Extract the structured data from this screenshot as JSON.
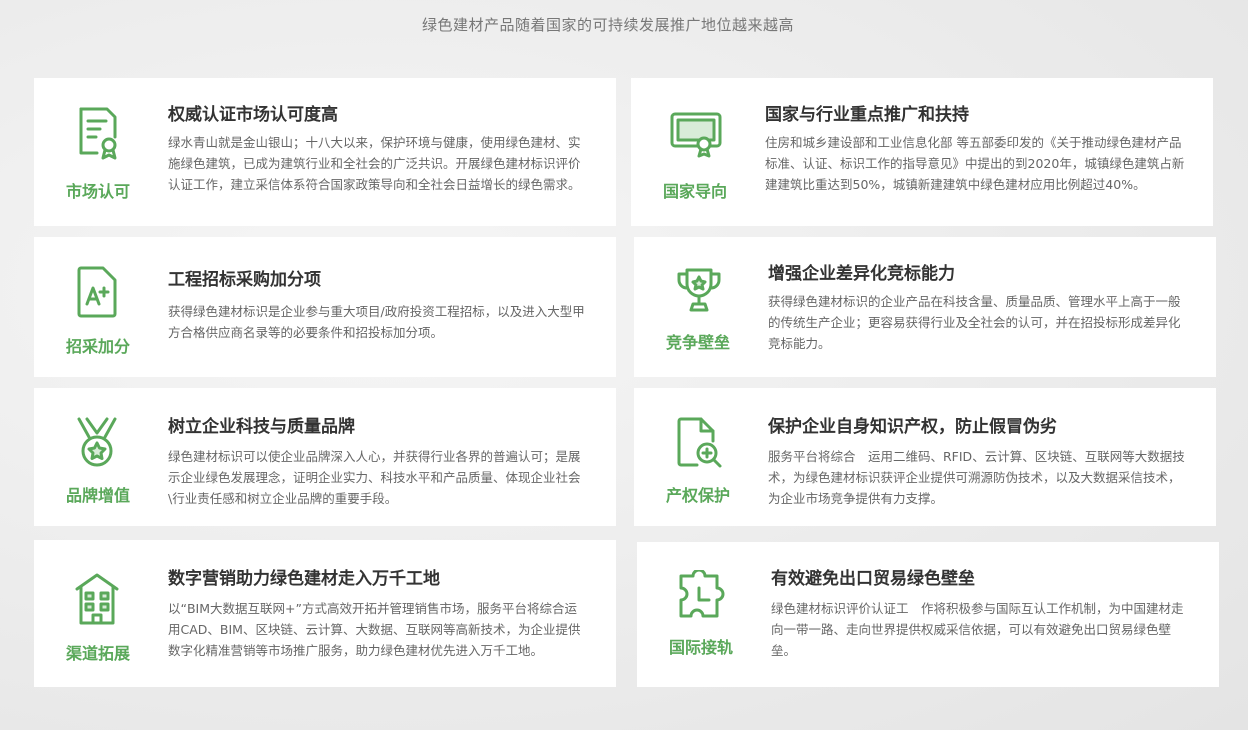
{
  "header": {
    "subtitle": "绿色建材产品随着国家的可持续发展推广地位越来越高"
  },
  "cards": [
    {
      "tag": "市场认可",
      "title": "权威认证市场认可度高",
      "desc": "绿水青山就是金山银山；十八大以来，保护环境与健康，使用绿色建材、实施绿色建筑，已成为建筑行业和全社会的广泛共识。开展绿色建材标识评价认证工作，建立采信体系符合国家政策导向和全社会日益增长的绿色需求。",
      "icon": "certificate-icon"
    },
    {
      "tag": "国家导向",
      "title": "国家与行业重点推广和扶持",
      "desc": "住房和城乡建设部和工业信息化部 等五部委印发的《关于推动绿色建材产品标准、认证、标识工作的指导意见》中提出的到2020年，城镇绿色建筑占新建建筑比重达到50%，城镇新建建筑中绿色建材应用比例超过40%。",
      "icon": "award-certificate-icon"
    },
    {
      "tag": "招采加分",
      "title": "工程招标采购加分项",
      "desc": "获得绿色建材标识是企业参与重大项目/政府投资工程招标，以及进入大型甲方合格供应商名录等的必要条件和招投标加分项。",
      "icon": "grade-document-icon"
    },
    {
      "tag": "竞争壁垒",
      "title": "增强企业差异化竞标能力",
      "desc": "获得绿色建材标识的企业产品在科技含量、质量品质、管理水平上高于一般的传统生产企业；更容易获得行业及全社会的认可，并在招投标形成差异化竞标能力。",
      "icon": "trophy-icon"
    },
    {
      "tag": "品牌增值",
      "title": "树立企业科技与质量品牌",
      "desc": "绿色建材标识可以使企业品牌深入人心，并获得行业各界的普遍认可；是展示企业绿色发展理念，证明企业实力、科技水平和产品质量、体现企业社会\\行业责任感和树立企业品牌的重要手段。",
      "icon": "medal-icon"
    },
    {
      "tag": "产权保护",
      "title": "保护企业自身知识产权，防止假冒伪劣",
      "desc": "服务平台将综合　运用二维码、RFID、云计算、区块链、互联网等大数据技术，为绿色建材标识获评企业提供可溯源防伪技术，以及大数据采信技术，为企业市场竞争提供有力支撑。",
      "icon": "document-search-icon"
    },
    {
      "tag": "渠道拓展",
      "title": "数字营销助力绿色建材走入万千工地",
      "desc": "以“BIM大数据互联网+”方式高效开拓并管理销售市场，服务平台将综合运用CAD、BIM、区块链、云计算、大数据、互联网等高新技术，为企业提供数字化精准营销等市场推广服务，助力绿色建材优先进入万千工地。",
      "icon": "building-icon"
    },
    {
      "tag": "国际接轨",
      "title": "有效避免出口贸易绿色壁垒",
      "desc": "绿色建材标识评价认证工　作将积极参与国际互认工作机制，为中国建材走向一带一路、走向世界提供权威采信依据，可以有效避免出口贸易绿色壁垒。",
      "icon": "puzzle-icon"
    }
  ],
  "colors": {
    "accent": "#5aa85a",
    "title": "#333333",
    "text": "#666666"
  }
}
